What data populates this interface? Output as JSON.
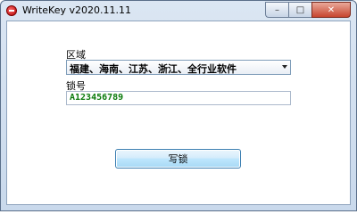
{
  "window": {
    "title": "WriteKey v2020.11.11",
    "min_glyph": "–",
    "max_glyph": "□",
    "close_glyph": "✕"
  },
  "form": {
    "region_label": "区域",
    "region_value": "福建、海南、江苏、浙江、全行业软件",
    "lock_label": "锁号",
    "lock_value": "A123456789",
    "write_button": "写锁"
  },
  "colors": {
    "lock_text": "#0a7a0a",
    "button_border": "#3c7fb1"
  }
}
